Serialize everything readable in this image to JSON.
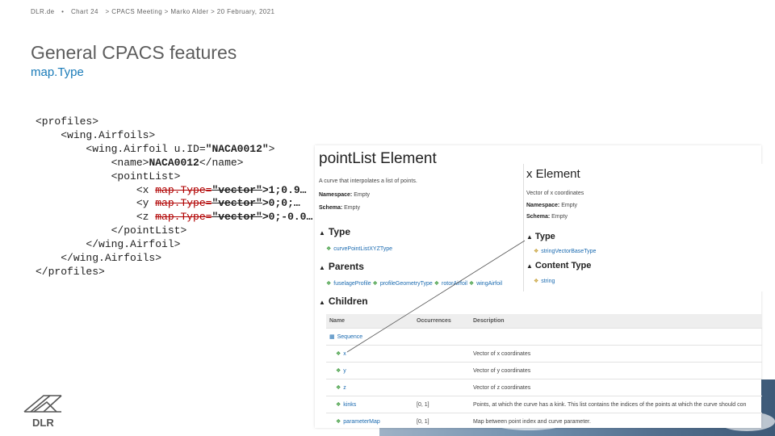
{
  "header": {
    "site": "DLR.de",
    "sep": "•",
    "chart": "Chart 24",
    "meta": "> CPACS Meeting > Marko Alder > 20 February, 2021"
  },
  "title": "General CPACS features",
  "subtitle": "map.Type",
  "code": {
    "l1": "<profiles>",
    "l2": "<wing.Airfoils>",
    "l3a": "<wing.Airfoil ",
    "l3b": "u.ID=",
    "l3c": "\"NACA0012\"",
    "l3d": ">",
    "l4a": "<name>",
    "l4b": "NACA0012",
    "l4c": "</name>",
    "l5": "<pointList>",
    "x_open": "<x ",
    "y_open": "<y ",
    "z_open": "<z ",
    "attr": "map.Type=",
    "attr_val": "\"vector\"",
    "x_val": ">1;0.9…",
    "y_val": ">0;0;…",
    "z_val": ">0;-0.0…",
    "l9": "</pointList>",
    "l10": "</wing.Airfoil>",
    "l11": "</wing.Airfoils>",
    "l12": "</profiles>"
  },
  "pointlist_panel": {
    "title": "pointList Element",
    "description": "A curve that interpolates a list of points.",
    "namespace_label": "Namespace:",
    "namespace_value": "Empty",
    "schema_label": "Schema:",
    "schema_value": "Empty",
    "type_heading": "Type",
    "type_link": "curvePointListXYZType",
    "parents_heading": "Parents",
    "parents_links": [
      "fuselageProfile",
      "profileGeometryType",
      "rotorAirfoil",
      "wingAirfoil"
    ],
    "children_heading": "Children",
    "table_headers": [
      "Name",
      "Occurrences",
      "Description"
    ],
    "sequence_label": "Sequence",
    "children": [
      {
        "name": "x",
        "occurrences": "",
        "description": "Vector of x coordinates"
      },
      {
        "name": "y",
        "occurrences": "",
        "description": "Vector of y coordinates"
      },
      {
        "name": "z",
        "occurrences": "",
        "description": "Vector of z coordinates"
      },
      {
        "name": "kinks",
        "occurrences": "[0, 1]",
        "description": "Points, at which the curve has a kink. This list contains the indices of the points at which the curve should con"
      },
      {
        "name": "parameterMap",
        "occurrences": "[0, 1]",
        "description": "Map between point index and curve parameter."
      }
    ]
  },
  "x_panel": {
    "title": "x Element",
    "description": "Vector of x coordinates",
    "namespace_label": "Namespace:",
    "namespace_value": "Empty",
    "schema_label": "Schema:",
    "schema_value": "Empty",
    "type_heading": "Type",
    "type_link": "stringVectorBaseType",
    "content_heading": "Content Type",
    "content_link": "string"
  },
  "icons": {
    "triangle": "▲",
    "link": "❖",
    "sequence": "▦"
  },
  "logo_text": "DLR",
  "colors": {
    "accent": "#1a7bb8",
    "link": "#1a6ab0",
    "strike": "#b00000"
  }
}
